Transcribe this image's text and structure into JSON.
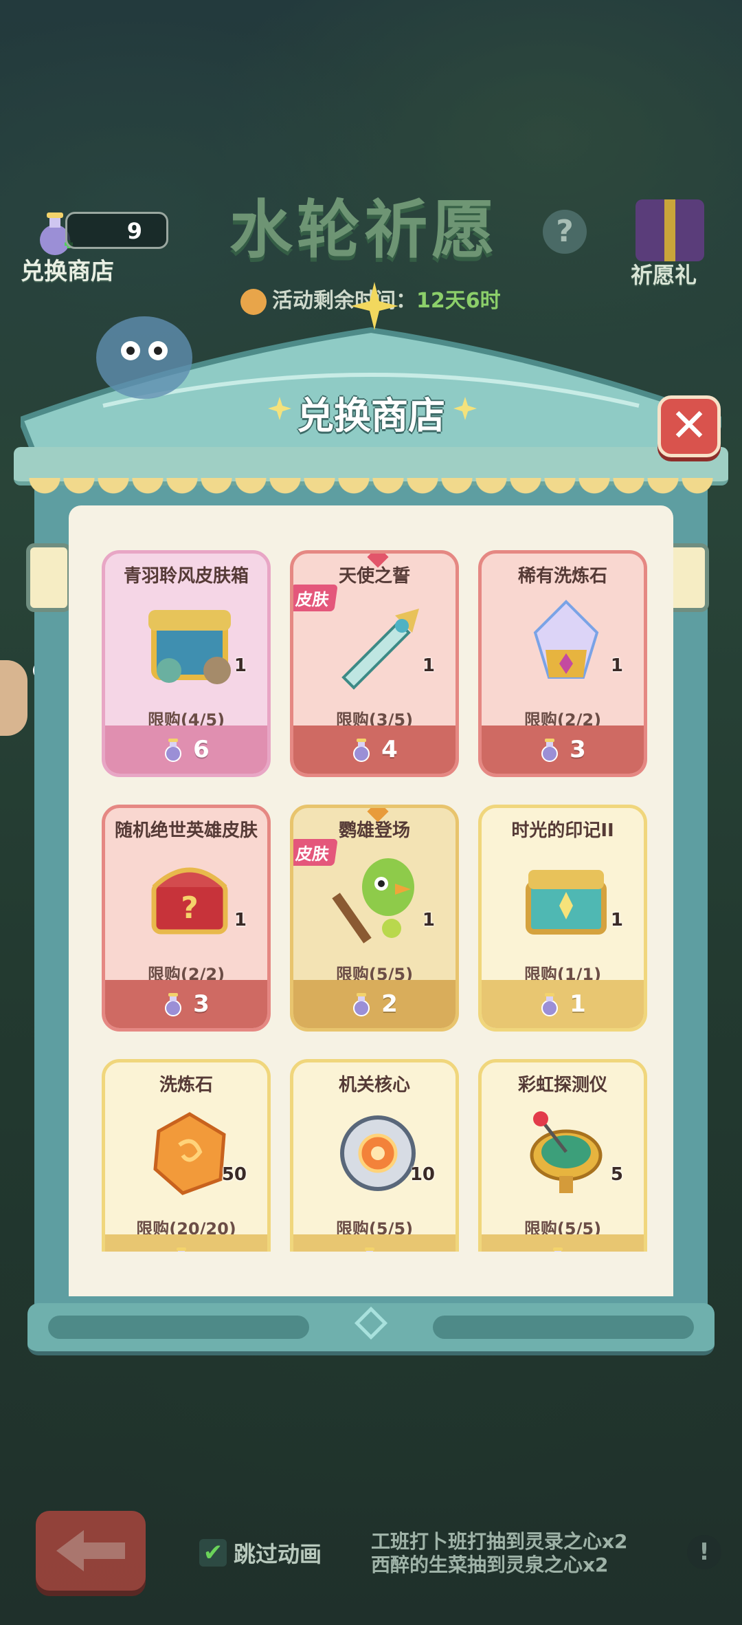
{
  "topbar": {
    "exchange_label": "兑换商店",
    "currency_value": "9",
    "event_title": "水轮祈愿",
    "help_symbol": "?",
    "gift_label": "祈愿礼",
    "timer_prefix": "活动剩余时间：",
    "timer_value": "12天6时"
  },
  "panel": {
    "title": "兑换商店",
    "close_symbol": "✕"
  },
  "skin_tag": "皮肤",
  "items": [
    {
      "name": "青羽聆风皮肤箱",
      "qty": "1",
      "limit": "限购(4/5)",
      "price": "6",
      "theme": "pink",
      "skin": false,
      "art": "chest-blue"
    },
    {
      "name": "天使之誓",
      "qty": "1",
      "limit": "限购(3/5)",
      "price": "4",
      "theme": "red",
      "skin": true,
      "art": "sword"
    },
    {
      "name": "稀有洗炼石",
      "qty": "1",
      "limit": "限购(2/2)",
      "price": "3",
      "theme": "red",
      "skin": false,
      "art": "crystal"
    },
    {
      "name": "随机绝世英雄皮肤",
      "qty": "1",
      "limit": "限购(2/2)",
      "price": "3",
      "theme": "red",
      "skin": false,
      "art": "chest-red"
    },
    {
      "name": "鹦雄登场",
      "qty": "1",
      "limit": "限购(5/5)",
      "price": "2",
      "theme": "gold",
      "skin": true,
      "art": "parrot-staff"
    },
    {
      "name": "时光的印记II",
      "qty": "1",
      "limit": "限购(1/1)",
      "price": "1",
      "theme": "yellow",
      "skin": false,
      "art": "chest-gold"
    },
    {
      "name": "洗炼石",
      "qty": "50",
      "limit": "限购(20/20)",
      "price": "",
      "theme": "yellow",
      "skin": false,
      "art": "stone-orange"
    },
    {
      "name": "机关核心",
      "qty": "10",
      "limit": "限购(5/5)",
      "price": "",
      "theme": "yellow",
      "skin": false,
      "art": "core"
    },
    {
      "name": "彩虹探测仪",
      "qty": "5",
      "limit": "限购(5/5)",
      "price": "",
      "theme": "yellow",
      "skin": false,
      "art": "detector"
    }
  ],
  "bottom": {
    "skip_label": "跳过动画",
    "check_symbol": "✔",
    "ticker_line1": "工班打卜班打抽到灵录之心x2",
    "ticker_line2": "西醉的生菜抽到灵泉之心x2",
    "info_symbol": "!"
  },
  "colors": {
    "panel_teal": "#5e9ea1",
    "card_pink": "#e08fb0",
    "card_red": "#cf6a63",
    "card_gold": "#d9ad5b",
    "card_yellow": "#e8c671",
    "close_red": "#d9534d"
  }
}
